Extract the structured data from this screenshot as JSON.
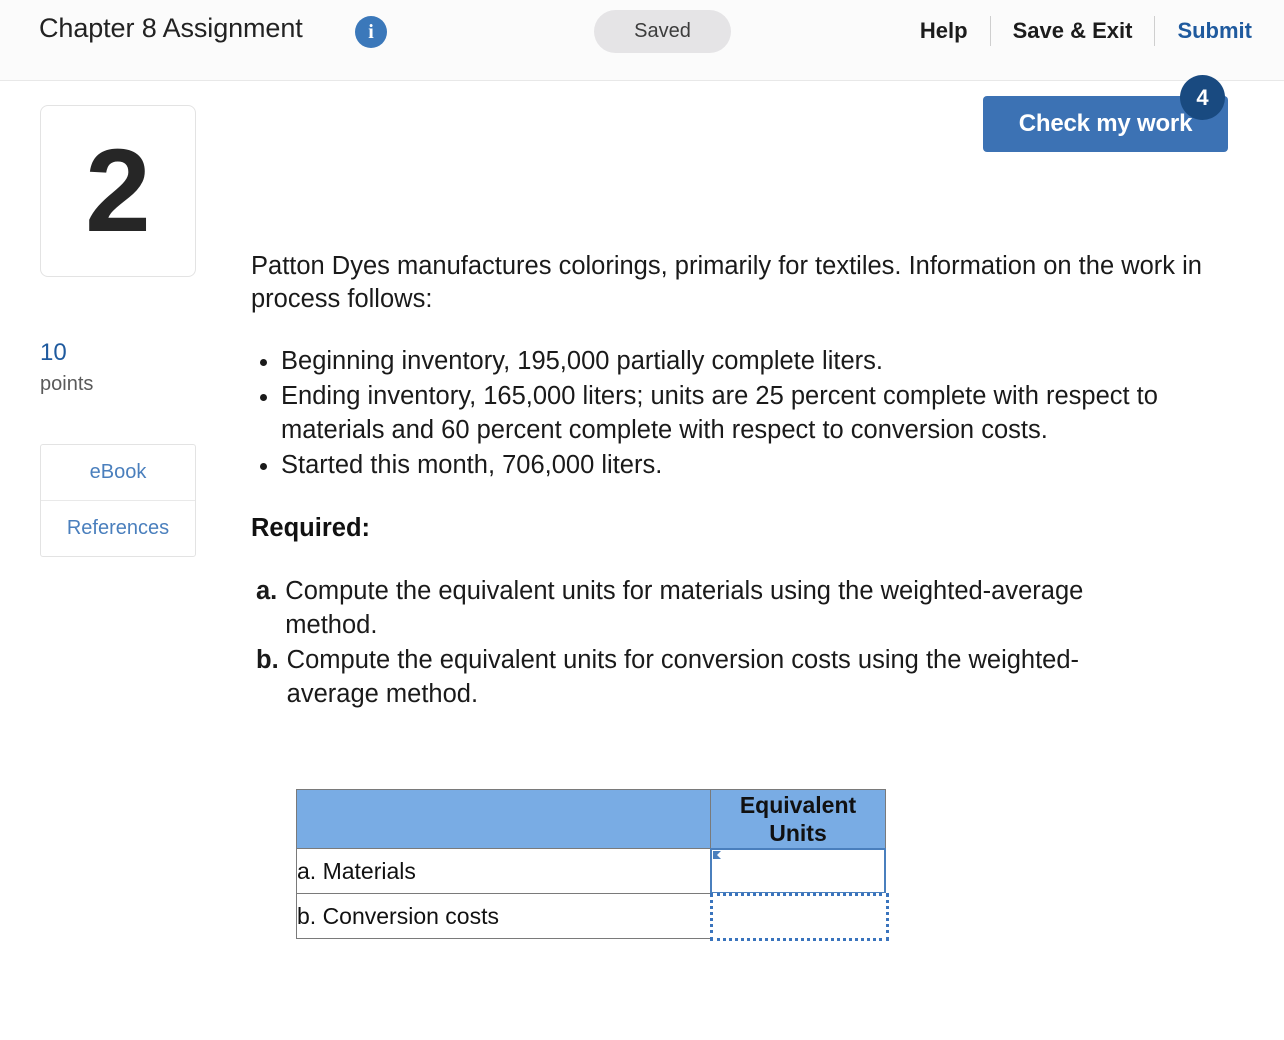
{
  "topbar": {
    "title": "Chapter 8 Assignment",
    "info_icon": "info-icon",
    "status_pill": "Saved",
    "nav": {
      "help": "Help",
      "save_exit": "Save & Exit",
      "submit": "Submit"
    }
  },
  "check_work": {
    "label": "Check my work",
    "badge_count": "4",
    "button_color": "#3c72b4",
    "badge_color": "#194a80"
  },
  "rail": {
    "question_number": "2",
    "points_value": "10",
    "points_label": "points",
    "resources": [
      {
        "label": "eBook"
      },
      {
        "label": "References"
      }
    ],
    "link_color": "#4a7fbd"
  },
  "problem": {
    "intro": "Patton Dyes manufactures colorings, primarily for textiles. Information on the work in process follows:",
    "facts": [
      "Beginning inventory, 195,000 partially complete liters.",
      "Ending inventory, 165,000 liters; units are 25 percent complete with respect to materials and 60 percent complete with respect to conversion costs.",
      "Started this month, 706,000 liters."
    ],
    "required_heading": "Required:",
    "requirements": [
      {
        "marker": "a.",
        "text": "Compute the equivalent units for materials using the weighted-average method."
      },
      {
        "marker": "b.",
        "text": "Compute the equivalent units for conversion costs using the weighted-average method."
      }
    ]
  },
  "answer_table": {
    "header_color": "#79ace4",
    "columns": [
      "",
      "Equivalent Units"
    ],
    "rows": [
      {
        "label": "a. Materials",
        "value": "",
        "state": "focused"
      },
      {
        "label": "b. Conversion costs",
        "value": "",
        "state": "dotted"
      }
    ]
  }
}
